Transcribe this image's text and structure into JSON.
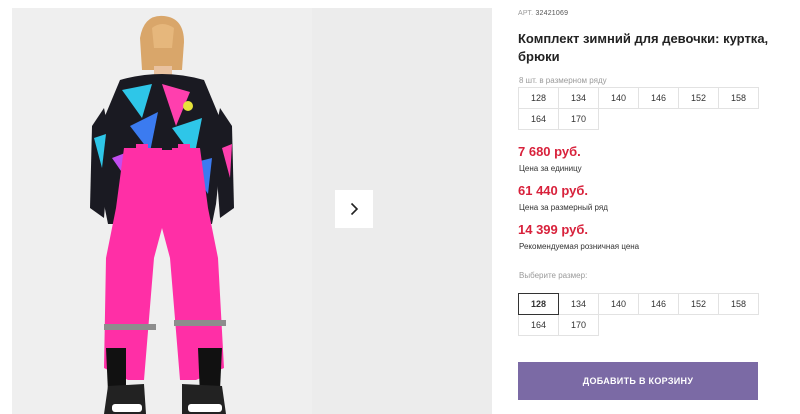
{
  "product": {
    "sku_label": "АРТ.",
    "sku": "32421069",
    "title": "Комплект зимний для девочки: куртка, брюки"
  },
  "pack": {
    "hint": "8 шт. в размерном ряду",
    "sizes": [
      "128",
      "134",
      "140",
      "146",
      "152",
      "158",
      "164",
      "170"
    ]
  },
  "prices": [
    {
      "value": "7 680 руб.",
      "label": "Цена за единицу"
    },
    {
      "value": "61 440 руб.",
      "label": "Цена за размерный ряд"
    },
    {
      "value": "14 399 руб.",
      "label": "Рекомендуемая розничная цена"
    }
  ],
  "size_select": {
    "label": "Выберите размер:",
    "sizes": [
      "128",
      "134",
      "140",
      "146",
      "152",
      "158",
      "164",
      "170"
    ],
    "selected": "128"
  },
  "cart": {
    "button_label": "ДОБАВИТЬ В КОРЗИНУ"
  },
  "colors": {
    "price": "#d8213b",
    "cart_button": "#7b6aa5",
    "pants": "#ff2fa6"
  },
  "icons": {
    "next": "chevron-right-icon"
  }
}
